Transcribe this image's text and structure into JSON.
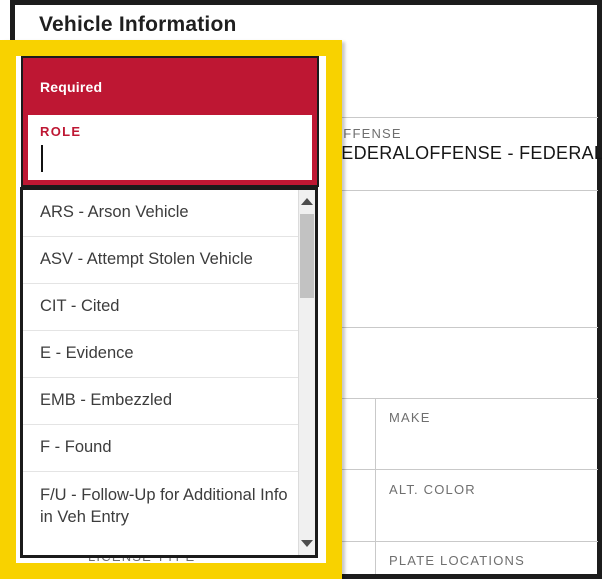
{
  "window": {
    "title": "Vehicle Information"
  },
  "role_dropdown": {
    "required_badge": "Required",
    "label": "ROLE",
    "value": "",
    "options": [
      "ARS - Arson Vehicle",
      "ASV - Attempt Stolen Vehicle",
      "CIT - Cited",
      "E - Evidence",
      "EMB - Embezzled",
      "F - Found",
      "F/U - Follow-Up for Additional Info in Veh Entry"
    ]
  },
  "form": {
    "offense": {
      "label": "OFFENSE",
      "value": "FEDERALOFFENSE - FEDERAL"
    },
    "make": {
      "label": "MAKE",
      "value": ""
    },
    "alt_color": {
      "label": "ALT. COLOR",
      "value": ""
    },
    "plate_locations": {
      "label": "PLATE LOCATIONS",
      "value": ""
    },
    "license_type": {
      "label": "LICENSE TYPE"
    }
  },
  "colors": {
    "accent_red": "#BE1733",
    "highlight_yellow": "#F8D200",
    "border_black": "#1C1C1C",
    "label_gray": "#6F6F6F"
  }
}
